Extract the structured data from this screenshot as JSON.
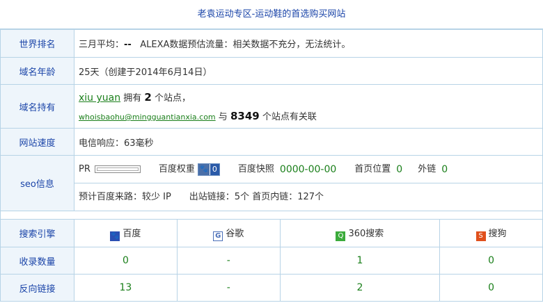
{
  "page_title": "老袁运动专区-运动鞋的首选购买网站",
  "rank": {
    "label": "世界排名",
    "prefix": "三月平均：",
    "value": "--",
    "alexa_text": "ALEXA数据预估流量：相关数据不充分，无法统计。"
  },
  "age": {
    "label": "域名年龄",
    "value": "25天（创建于2014年6月14日）"
  },
  "owner": {
    "label": "域名持有",
    "name": "xiu yuan",
    "has_text": "拥有",
    "site_count": "2",
    "sites_suffix": "个站点，",
    "email": "whoisbaohu@mingguantianxia.com",
    "with_text": "与",
    "related_count": "8349",
    "related_suffix": "个站点有关联"
  },
  "speed": {
    "label": "网站速度",
    "value": "电信响应：63毫秒"
  },
  "seo": {
    "label": "seo信息",
    "pr_label": "PR",
    "baidu_weight_label": "百度权重",
    "baidu_weight_value": "0",
    "snapshot_label": "百度快照",
    "snapshot_value": "0000-00-00",
    "homepage_pos_label": "首页位置",
    "homepage_pos_value": "0",
    "external_label": "外链",
    "external_value": "0",
    "line2": "预计百度来路：较少 IP　　出站链接：5个 首页内链：127个"
  },
  "search_engines": {
    "header_label": "搜索引擎",
    "engines": [
      {
        "name": "百度",
        "icon": "baidu-icon",
        "glyph": "🐾"
      },
      {
        "name": "谷歌",
        "icon": "google-icon",
        "glyph": "G"
      },
      {
        "name": "360搜索",
        "icon": "360-search-icon",
        "glyph": "Q"
      },
      {
        "name": "搜狗",
        "icon": "sogou-icon",
        "glyph": "S"
      }
    ],
    "rows": [
      {
        "label": "收录数量",
        "values": [
          "0",
          "-",
          "1",
          "0"
        ]
      },
      {
        "label": "反向链接",
        "values": [
          "13",
          "-",
          "2",
          "0"
        ]
      }
    ]
  }
}
